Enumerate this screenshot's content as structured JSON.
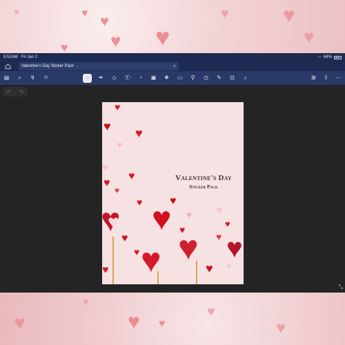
{
  "status_bar": {
    "time": "5:51AM",
    "date": "Fri Jan 2",
    "battery": "84%"
  },
  "tab": {
    "title": "Valentine's Day Sticker Pack"
  },
  "toolbar": {
    "left_icons": [
      "sidebar-icon",
      "search-icon",
      "share-arrow-icon",
      "bookmark-icon"
    ],
    "tool_icons": [
      "lasso-icon",
      "pen-icon",
      "eraser-icon",
      "text-box-icon",
      "shape-icon",
      "image-icon",
      "sticker-icon",
      "highlighter-icon",
      "link-icon",
      "timer-icon",
      "pencil-icon",
      "scan-icon",
      "microphone-icon"
    ],
    "right_icons": [
      "add-page-icon",
      "export-icon",
      "more-icon"
    ]
  },
  "document": {
    "title": "Valentine's Day",
    "subtitle": "Sticker Pack"
  },
  "colors": {
    "status_bar_bg": "#1d2a52",
    "toolbar_bg": "#2a3a68",
    "canvas_bg": "#242424",
    "page_bg": "#f7e2e3",
    "heart_red": "#d8192a"
  }
}
